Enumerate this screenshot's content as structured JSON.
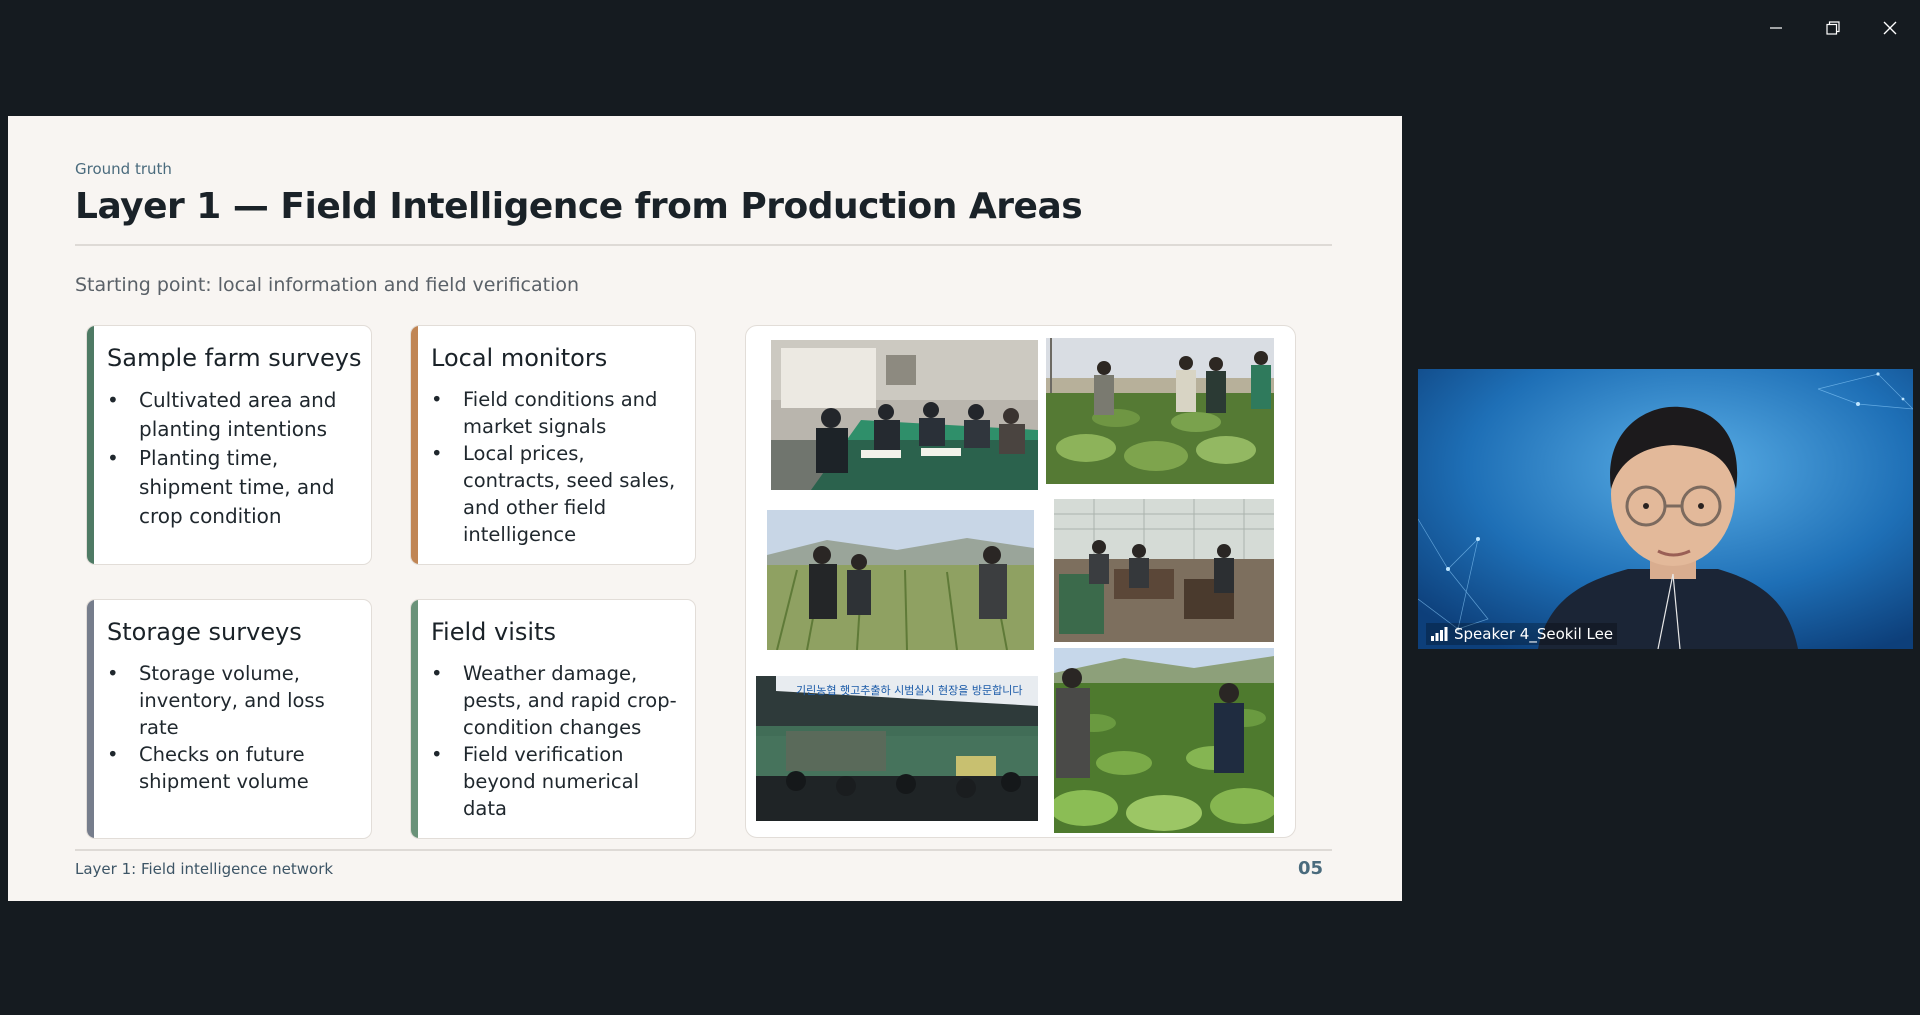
{
  "window": {
    "controls": [
      {
        "name": "minimize-icon"
      },
      {
        "name": "restore-icon"
      },
      {
        "name": "close-icon"
      }
    ]
  },
  "slide": {
    "eyebrow": "Ground truth",
    "title": "Layer 1 — Field Intelligence from Production Areas",
    "subtitle": "Starting point: local information and field verification",
    "cards": [
      {
        "title": "Sample farm surveys",
        "accent": "#4e7a64",
        "bullets": [
          "Cultivated area and planting intentions",
          "Planting time, shipment time, and crop condition"
        ]
      },
      {
        "title": "Local monitors",
        "accent": "#c08554",
        "bullets": [
          "Field conditions and market signals",
          "Local prices, contracts, seed sales, and other field intelligence"
        ]
      },
      {
        "title": "Storage surveys",
        "accent": "#767d8c",
        "bullets": [
          "Storage volume, inventory, and loss rate",
          "Checks on future shipment volume"
        ]
      },
      {
        "title": "Field visits",
        "accent": "#6a9279",
        "bullets": [
          "Weather damage, pests, and rapid crop-condition changes",
          "Field verification beyond numerical data"
        ]
      }
    ],
    "photo_banner_text": "기린농협 햇고추출하 시범실시 현장을 방문합니다",
    "footer": "Layer 1: Field intelligence network",
    "page_number": "05"
  },
  "video": {
    "speaker": "Speaker 4_Seokil Lee"
  }
}
